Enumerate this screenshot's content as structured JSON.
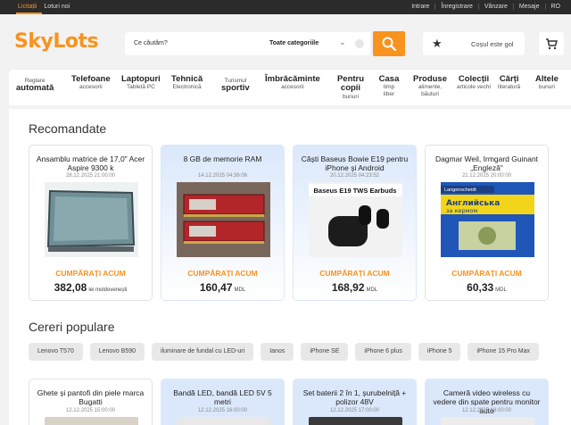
{
  "topbar": {
    "left": [
      "Licitații",
      "Loturi noi"
    ],
    "right": [
      "Intrare",
      "Înregistrare",
      "Vânzare",
      "Mesaje",
      "RO"
    ]
  },
  "header": {
    "logo": "SkyLots",
    "search_placeholder": "Ce căutăm?",
    "search_category": "Toate categoriile",
    "favorites_text": "Coșul este gol"
  },
  "categories": [
    {
      "pre": "Reglare",
      "bottom": "automată"
    },
    {
      "title": "Telefoane",
      "sub": "accesorii"
    },
    {
      "title": "Laptopuri",
      "sub": "Tabletă PC"
    },
    {
      "title": "Tehnică",
      "sub": "Electronică"
    },
    {
      "pre": "Turismul",
      "bottom": "sportiv"
    },
    {
      "title": "Îmbrăcăminte",
      "sub": "accesorii"
    },
    {
      "title": "Pentru copii",
      "sub": "bunuri"
    },
    {
      "title": "Casa",
      "sub": "timp liber"
    },
    {
      "title": "Produse",
      "sub": "alimente, băuturi"
    },
    {
      "title": "Colecții",
      "sub": "articole vechi"
    },
    {
      "title": "Cărți",
      "sub": "literatură"
    },
    {
      "title": "Altele",
      "sub": "bunuri"
    }
  ],
  "recommended": {
    "title": "Recomandate",
    "items": [
      {
        "title": "Ansamblu matrice de 17,0\" Acer Aspire 9300 k",
        "date": "28.12.2025 21:00:00",
        "cta": "CUMPĂRAȚI ACUM",
        "price": "382,08",
        "currency": "lei moldovenești"
      },
      {
        "title": "8 GB de memorie RAM",
        "date": "14.12.2025 04:36:06",
        "cta": "CUMPĂRAȚI ACUM",
        "price": "160,47",
        "currency": "MDL"
      },
      {
        "title": "Căști Baseus Bowie E19 pentru iPhone și Android",
        "date": "20.12.2025 04:23:52",
        "cta": "CUMPĂRAȚI ACUM",
        "price": "168,92",
        "currency": "MDL",
        "img_label": "Baseus E19 TWS Earbuds"
      },
      {
        "title": "Dagmar Weil, Irmgard Guinant „Engleză”",
        "date": "21.12.2025 20:00:00",
        "cta": "CUMPĂRAȚI ACUM",
        "price": "60,33",
        "currency": "MDL",
        "img_label1": "Langenscheidt",
        "img_label2": "Английська",
        "img_label3": "за кермом"
      }
    ]
  },
  "popular": {
    "title": "Cereri populare",
    "tags": [
      "Lenovo T570",
      "Lenovo B590",
      "iluminare de fundal cu LED-uri",
      "Ianos",
      "iPhone SE",
      "iPhone 6 plus",
      "iPhone 5",
      "iPhone 15 Pro Max"
    ]
  },
  "more": [
    {
      "title": "Ghete și pantofi din piele marca Bugatti",
      "date": "12.12.2025 15:00:00"
    },
    {
      "title": "Bandă LED, bandă LED 5V 5 metri",
      "date": "12.12.2025 16:00:00"
    },
    {
      "title": "Set baterii 2 în 1, șurubelniță + polizor 48V",
      "date": "12.12.2025 17:00:00"
    },
    {
      "title": "Cameră video wireless cu vedere din spate pentru monitor auto",
      "date": "12.12.2025 18:00:00"
    }
  ],
  "colors": {
    "accent": "#f7931e",
    "card_blue": "#dbe8fb",
    "topbar": "#2b2b2b"
  }
}
